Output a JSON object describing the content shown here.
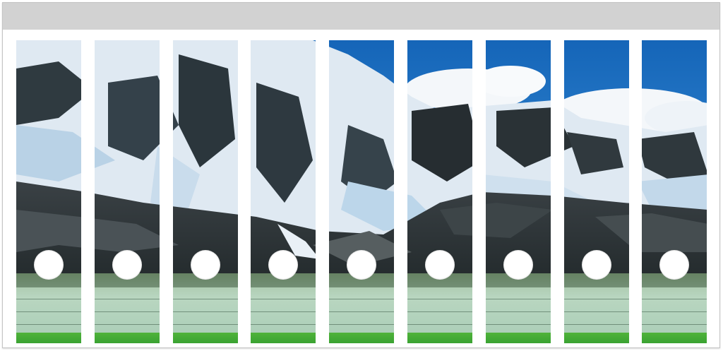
{
  "sheet": {
    "header_color": "#d2d2d2",
    "strip_count": 9,
    "image_subject": "",
    "colors": {
      "sky": "#1f7fd0",
      "cloud": "#f4f7fa",
      "snow": "#e6eef5",
      "rock": "#2e3437",
      "water": "#9bb8a3",
      "footer_green": "#3aa232"
    }
  }
}
